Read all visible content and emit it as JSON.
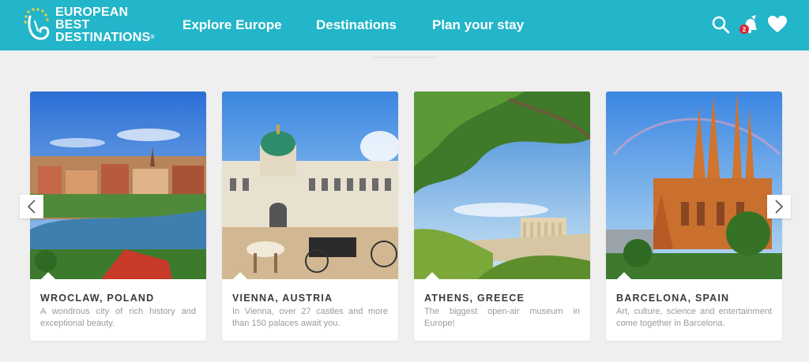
{
  "header": {
    "logo": {
      "line1": "European Best",
      "line2": "Destinations",
      "reg": "®"
    },
    "nav": [
      {
        "label": "Explore Europe"
      },
      {
        "label": "Destinations"
      },
      {
        "label": "Plan your stay"
      }
    ],
    "icons": {
      "search": "search-icon",
      "notifications": "bell-icon",
      "favorites": "heart-icon"
    },
    "notification_count": "2",
    "colors": {
      "bar": "#23b5c9",
      "badge": "#d9263a"
    }
  },
  "carousel": {
    "prev_icon": "chevron-left-icon",
    "next_icon": "chevron-right-icon",
    "cards": [
      {
        "title": "Wroclaw, Poland",
        "desc": "A wondrous city of rich history and exceptional beauty."
      },
      {
        "title": "Vienna, Austria",
        "desc": "In Vienna, over 27 castles and more than 150 palaces await you."
      },
      {
        "title": "Athens, Greece",
        "desc": "The biggest open-air museum in Europe!"
      },
      {
        "title": "Barcelona, Spain",
        "desc": "Art, culture, science and entertainment come together in Barcelona."
      }
    ]
  }
}
